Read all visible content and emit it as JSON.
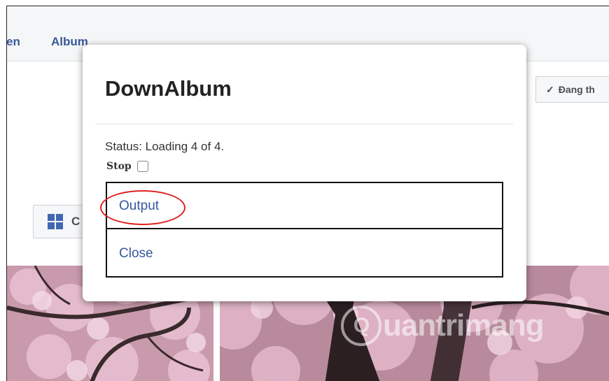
{
  "nav": {
    "links": [
      "en",
      "Album"
    ]
  },
  "buttons": {
    "follow": "Đang th",
    "grid": "C"
  },
  "modal": {
    "title": "DownAlbum",
    "status": "Status: Loading 4 of 4.",
    "stop_label": "Stop",
    "output_label": "Output",
    "close_label": "Close"
  },
  "watermark": {
    "logo_letter": "Q",
    "text": "uantrimang"
  },
  "colors": {
    "link": "#36589e",
    "highlight_ring": "#e02020"
  }
}
